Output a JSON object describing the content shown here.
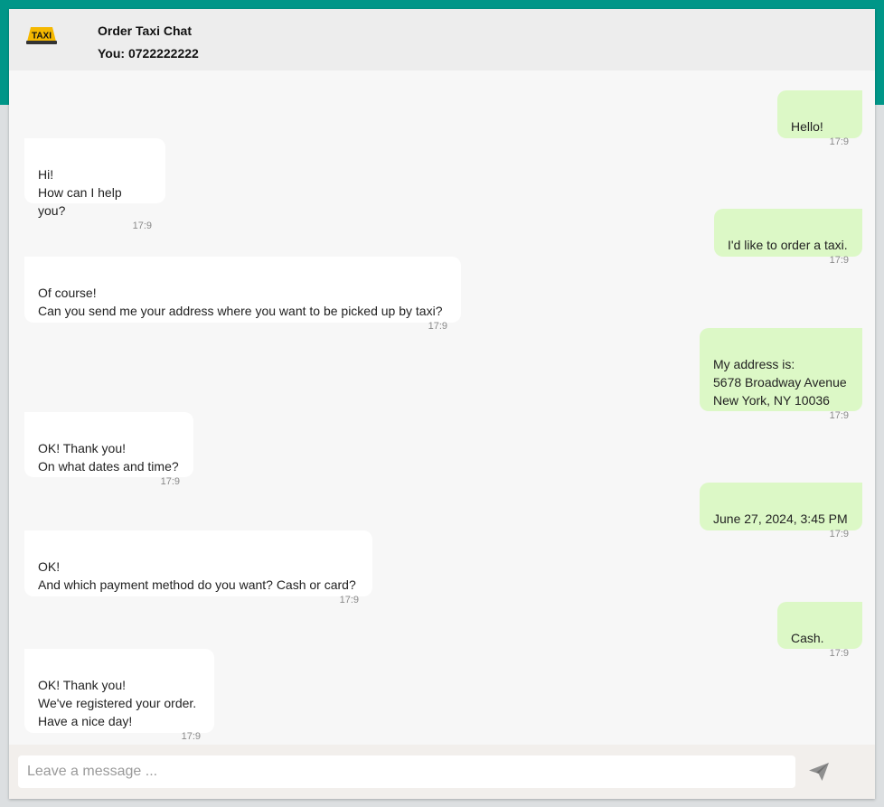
{
  "header": {
    "logo_text": "TAXI",
    "title": "Order Taxi Chat",
    "subtitle": "You: 0722222222"
  },
  "messages": [
    {
      "from": "me",
      "text": "Hello!",
      "time": "17:9"
    },
    {
      "from": "them",
      "text": "Hi!\nHow can I help you?",
      "time": "17:9"
    },
    {
      "from": "me",
      "text": "I'd like to order a taxi.",
      "time": "17:9"
    },
    {
      "from": "them",
      "text": "Of course!\nCan you send me your address where you want to be picked up by taxi?",
      "time": "17:9"
    },
    {
      "from": "me",
      "text": "My address is:\n5678 Broadway Avenue\nNew York, NY 10036",
      "time": "17:9"
    },
    {
      "from": "them",
      "text": "OK! Thank you!\nOn what dates and time?",
      "time": "17:9"
    },
    {
      "from": "me",
      "text": "June 27, 2024, 3:45 PM",
      "time": "17:9"
    },
    {
      "from": "them",
      "text": "OK!\nAnd which payment method do you want? Cash or card?",
      "time": "17:9"
    },
    {
      "from": "me",
      "text": "Cash.",
      "time": "17:9"
    },
    {
      "from": "them",
      "text": "OK! Thank you!\nWe've registered your order.\nHave a nice day!",
      "time": "17:9"
    }
  ],
  "composer": {
    "placeholder": "Leave a message ...",
    "send_icon": "paper-plane-icon"
  },
  "colors": {
    "accent": "#009688",
    "my_bubble": "#dcf8c6",
    "their_bubble": "#ffffff",
    "taxi_sign": "#f5b800"
  }
}
